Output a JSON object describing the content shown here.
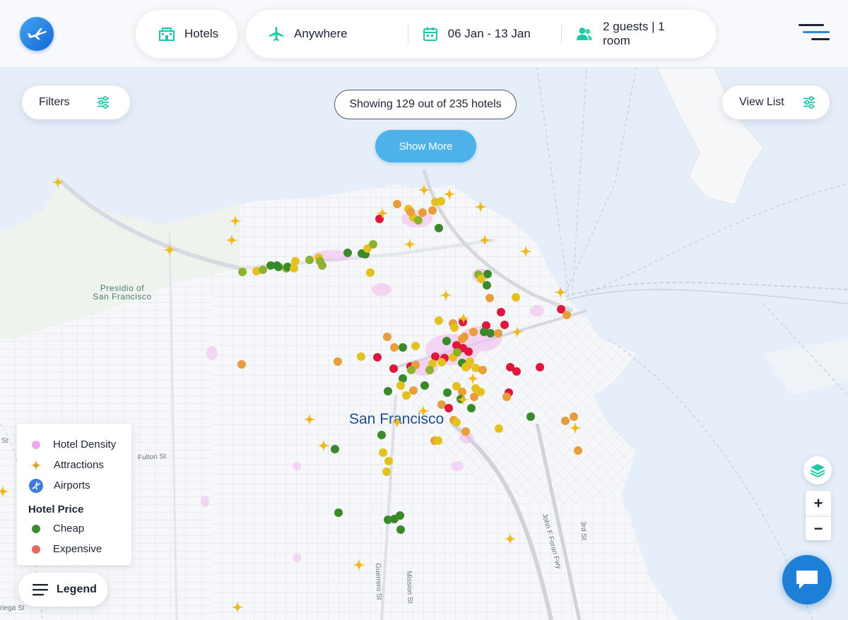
{
  "header": {
    "logo_icon": "airplane-logo-icon",
    "hotels_label": "Hotels",
    "destination_label": "Anywhere",
    "dates_label": "06 Jan - 13 Jan",
    "guests_label": "2 guests | 1 room",
    "accent_color": "#1ec8a5"
  },
  "controls": {
    "filters_label": "Filters",
    "view_list_label": "View List",
    "showing_text": "Showing 129 out of 235 hotels",
    "show_more_label": "Show More",
    "legend_button_label": "Legend",
    "zoom_in": "+",
    "zoom_out": "−"
  },
  "map": {
    "city_label": "San Francisco",
    "area_label_line1": "Presidio of",
    "area_label_line2": "San Francisco",
    "streets": [
      "Fulton St",
      "Guerrero St",
      "Mission St",
      "John F Foran Fwy",
      "3rd St",
      "riega St"
    ],
    "street_fragments": [
      "St"
    ]
  },
  "legend": {
    "items": [
      {
        "label": "Hotel Density",
        "color": "#ec9ee6",
        "icon": "density-dot-icon"
      },
      {
        "label": "Attractions",
        "color": "#e6b53a",
        "icon": "star-icon"
      },
      {
        "label": "Airports",
        "color": "#3d7be0",
        "icon": "airport-icon"
      }
    ],
    "price_title": "Hotel Price",
    "price_items": [
      {
        "label": "Cheap",
        "color": "#3d8a2f"
      },
      {
        "label": "Expensive",
        "color": "#e26a62"
      }
    ]
  },
  "colors": {
    "cheap": "#3a8a2c",
    "mid_low": "#8fb22e",
    "mid": "#e3c21e",
    "mid_high": "#e89d3b",
    "expensive": "#e0173c",
    "attraction": "#f0b81c"
  }
}
